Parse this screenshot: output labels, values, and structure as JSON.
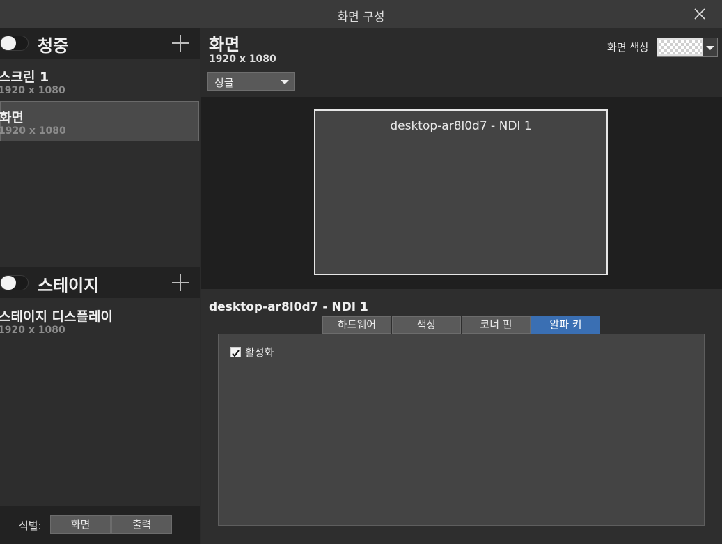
{
  "window": {
    "title": "화면 구성"
  },
  "left": {
    "audience": {
      "title": "청중",
      "items": [
        {
          "name": "스크린 1",
          "res": "1920 x 1080"
        },
        {
          "name": "화면",
          "res": "1920 x 1080"
        }
      ]
    },
    "stage": {
      "title": "스테이지",
      "items": [
        {
          "name": "스테이지 디스플레이",
          "res": "1920 x 1080"
        }
      ]
    },
    "footer": {
      "label": "식별:",
      "buttons": [
        "화면",
        "출력"
      ]
    }
  },
  "screen": {
    "title": "화면",
    "res": "1920 x 1080",
    "color_label": "화면 색상",
    "mode": "싱글"
  },
  "preview": {
    "layer_caption": "desktop-ar8l0d7 - NDI 1"
  },
  "props": {
    "source_name": "desktop-ar8l0d7 - NDI 1",
    "tabs": [
      "하드웨어",
      "색상",
      "코너 핀",
      "알파 키"
    ],
    "active_tab": "알파 키",
    "enable_label": "활성화",
    "enable_checked": true
  },
  "colors": {
    "accent": "#3a6fb3",
    "panel_bg": "#444444",
    "header_bg": "#222222"
  }
}
